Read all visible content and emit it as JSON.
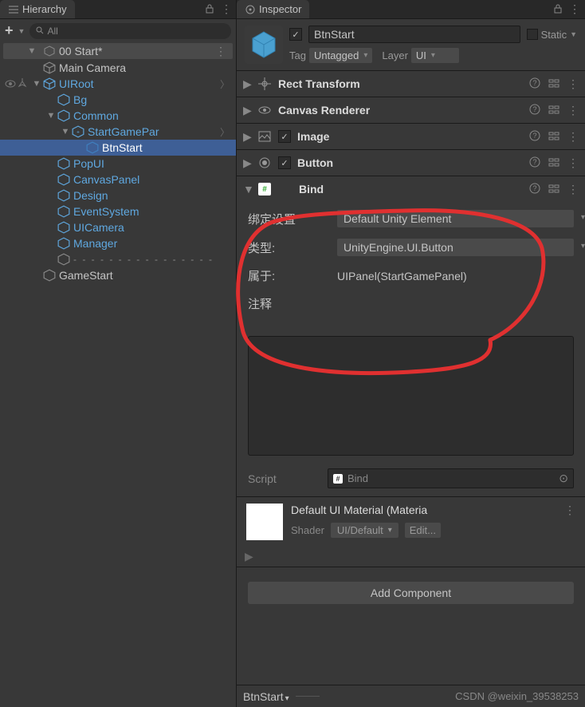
{
  "hierarchy": {
    "panel_title": "Hierarchy",
    "search_placeholder": "All",
    "scene_name": "00 Start*",
    "items": {
      "main_camera": "Main Camera",
      "uiroot": "UIRoot",
      "bg": "Bg",
      "common": "Common",
      "startgamepanel": "StartGamePar",
      "btnstart": "BtnStart",
      "popui": "PopUI",
      "canvaspanel": "CanvasPanel",
      "design": "Design",
      "eventsystem": "EventSystem",
      "uicamera": "UICamera",
      "manager": "Manager",
      "divider": "- - - - - - - - - - - - - - - -",
      "gamestart": "GameStart"
    }
  },
  "inspector": {
    "panel_title": "Inspector",
    "object_name": "BtnStart",
    "static_label": "Static",
    "tag_label": "Tag",
    "tag_value": "Untagged",
    "layer_label": "Layer",
    "layer_value": "UI",
    "components": {
      "rect": "Rect Transform",
      "canvas_renderer": "Canvas Renderer",
      "image": "Image",
      "button": "Button",
      "bind": "Bind"
    },
    "bind": {
      "label_settings": "绑定设置",
      "value_settings": "Default Unity Element",
      "label_type": "类型:",
      "value_type": "UnityEngine.UI.Button",
      "label_belongs": "属于:",
      "value_belongs": "UIPanel(StartGamePanel)",
      "label_comment": "注释"
    },
    "script_label": "Script",
    "script_value": "Bind",
    "material_title": "Default UI Material (Materia",
    "shader_label": "Shader",
    "shader_value": "UI/Default",
    "edit_btn": "Edit...",
    "add_component": "Add Component"
  },
  "bottom": {
    "object": "BtnStart",
    "watermark": "CSDN @weixin_39538253"
  }
}
